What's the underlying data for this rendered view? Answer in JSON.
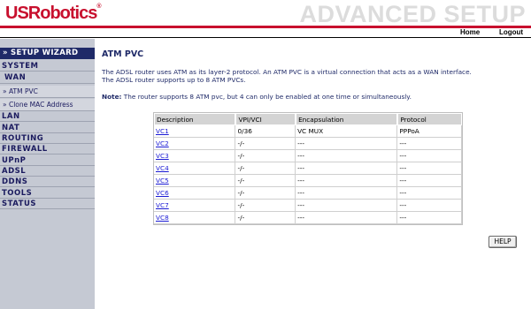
{
  "header": {
    "logo": "USRobotics",
    "logo_mark": "®",
    "banner": "ADVANCED SETUP",
    "nav": {
      "home": "Home",
      "logout": "Logout"
    }
  },
  "sidebar": {
    "title": "» SETUP WIZARD",
    "items": [
      {
        "label": "SYSTEM"
      },
      {
        "label": "WAN"
      },
      {
        "label": "» ATM PVC"
      },
      {
        "label": "» Clone MAC Address"
      },
      {
        "label": "LAN"
      },
      {
        "label": "NAT"
      },
      {
        "label": "ROUTING"
      },
      {
        "label": "FIREWALL"
      },
      {
        "label": "UPnP"
      },
      {
        "label": "ADSL"
      },
      {
        "label": "DDNS"
      },
      {
        "label": "TOOLS"
      },
      {
        "label": "STATUS"
      }
    ]
  },
  "main": {
    "title": "ATM PVC",
    "desc_line1": "The ADSL router uses ATM as its layer-2 protocol. An ATM PVC is a virtual connection that acts as a WAN interface.",
    "desc_line2": "The ADSL router supports up to 8 ATM PVCs.",
    "note_label": "Note:",
    "note_text": " The router supports 8 ATM pvc, but 4 can only be enabled at one time or simultaneously.",
    "table": {
      "headers": [
        "Description",
        "VPI/VCI",
        "Encapsulation",
        "Protocol"
      ],
      "rows": [
        {
          "description": "VC1",
          "vpi_vci": "0/36",
          "encapsulation": "VC MUX",
          "protocol": "PPPoA"
        },
        {
          "description": "VC2",
          "vpi_vci": "-/-",
          "encapsulation": "---",
          "protocol": "---"
        },
        {
          "description": "VC3",
          "vpi_vci": "-/-",
          "encapsulation": "---",
          "protocol": "---"
        },
        {
          "description": "VC4",
          "vpi_vci": "-/-",
          "encapsulation": "---",
          "protocol": "---"
        },
        {
          "description": "VC5",
          "vpi_vci": "-/-",
          "encapsulation": "---",
          "protocol": "---"
        },
        {
          "description": "VC6",
          "vpi_vci": "-/-",
          "encapsulation": "---",
          "protocol": "---"
        },
        {
          "description": "VC7",
          "vpi_vci": "-/-",
          "encapsulation": "---",
          "protocol": "---"
        },
        {
          "description": "VC8",
          "vpi_vci": "-/-",
          "encapsulation": "---",
          "protocol": "---"
        }
      ]
    },
    "help_label": "HELP"
  },
  "colors": {
    "brand_red": "#c8102e",
    "navy": "#1f2a68",
    "sidebar_bg": "#c5c9d3",
    "link_blue": "#1a1ad4"
  }
}
